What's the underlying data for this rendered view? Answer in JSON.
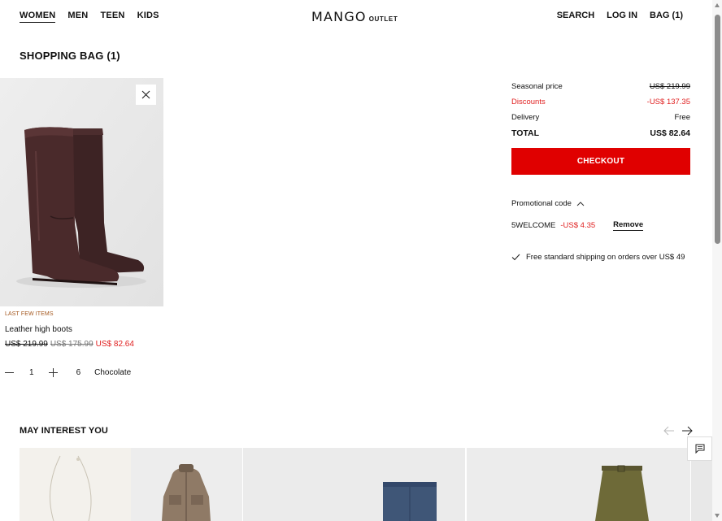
{
  "header": {
    "nav_left": [
      "WOMEN",
      "MEN",
      "TEEN",
      "KIDS"
    ],
    "active_nav": "WOMEN",
    "logo_brand": "MANGO",
    "logo_suffix": "OUTLET",
    "search": "SEARCH",
    "login": "LOG IN",
    "bag": "BAG (1)"
  },
  "page_title": "SHOPPING BAG (1)",
  "product": {
    "badge": "LAST FEW ITEMS",
    "name": "Leather high boots",
    "price_original": "US$ 219.99",
    "price_previous": "US$ 175.99",
    "price_current": "US$ 82.64",
    "quantity": "1",
    "size": "6",
    "color": "Chocolate"
  },
  "summary": {
    "seasonal_label": "Seasonal price",
    "seasonal_value": "US$ 219.99",
    "discounts_label": "Discounts",
    "discounts_value": "-US$ 137.35",
    "delivery_label": "Delivery",
    "delivery_value": "Free",
    "total_label": "TOTAL",
    "total_value": "US$ 82.64",
    "checkout_label": "CHECKOUT"
  },
  "promo": {
    "toggle_label": "Promotional code",
    "code": "5WELCOME",
    "discount": "-US$ 4.35",
    "remove_label": "Remove"
  },
  "shipping_note": "Free standard shipping on orders over US$ 49",
  "recommendations": {
    "title": "MAY INTEREST YOU",
    "items": [
      "necklace",
      "jacket",
      "jeans",
      "skirt"
    ]
  },
  "colors": {
    "accent_red": "#e00000",
    "sale_red": "#e02020",
    "badge_brown": "#a3561c"
  },
  "icons": {
    "close": "close-icon",
    "promo_toggle": "chevron-up-icon",
    "check": "check-icon",
    "prev": "arrow-left-icon",
    "next": "arrow-right-icon",
    "chat": "chat-icon"
  }
}
